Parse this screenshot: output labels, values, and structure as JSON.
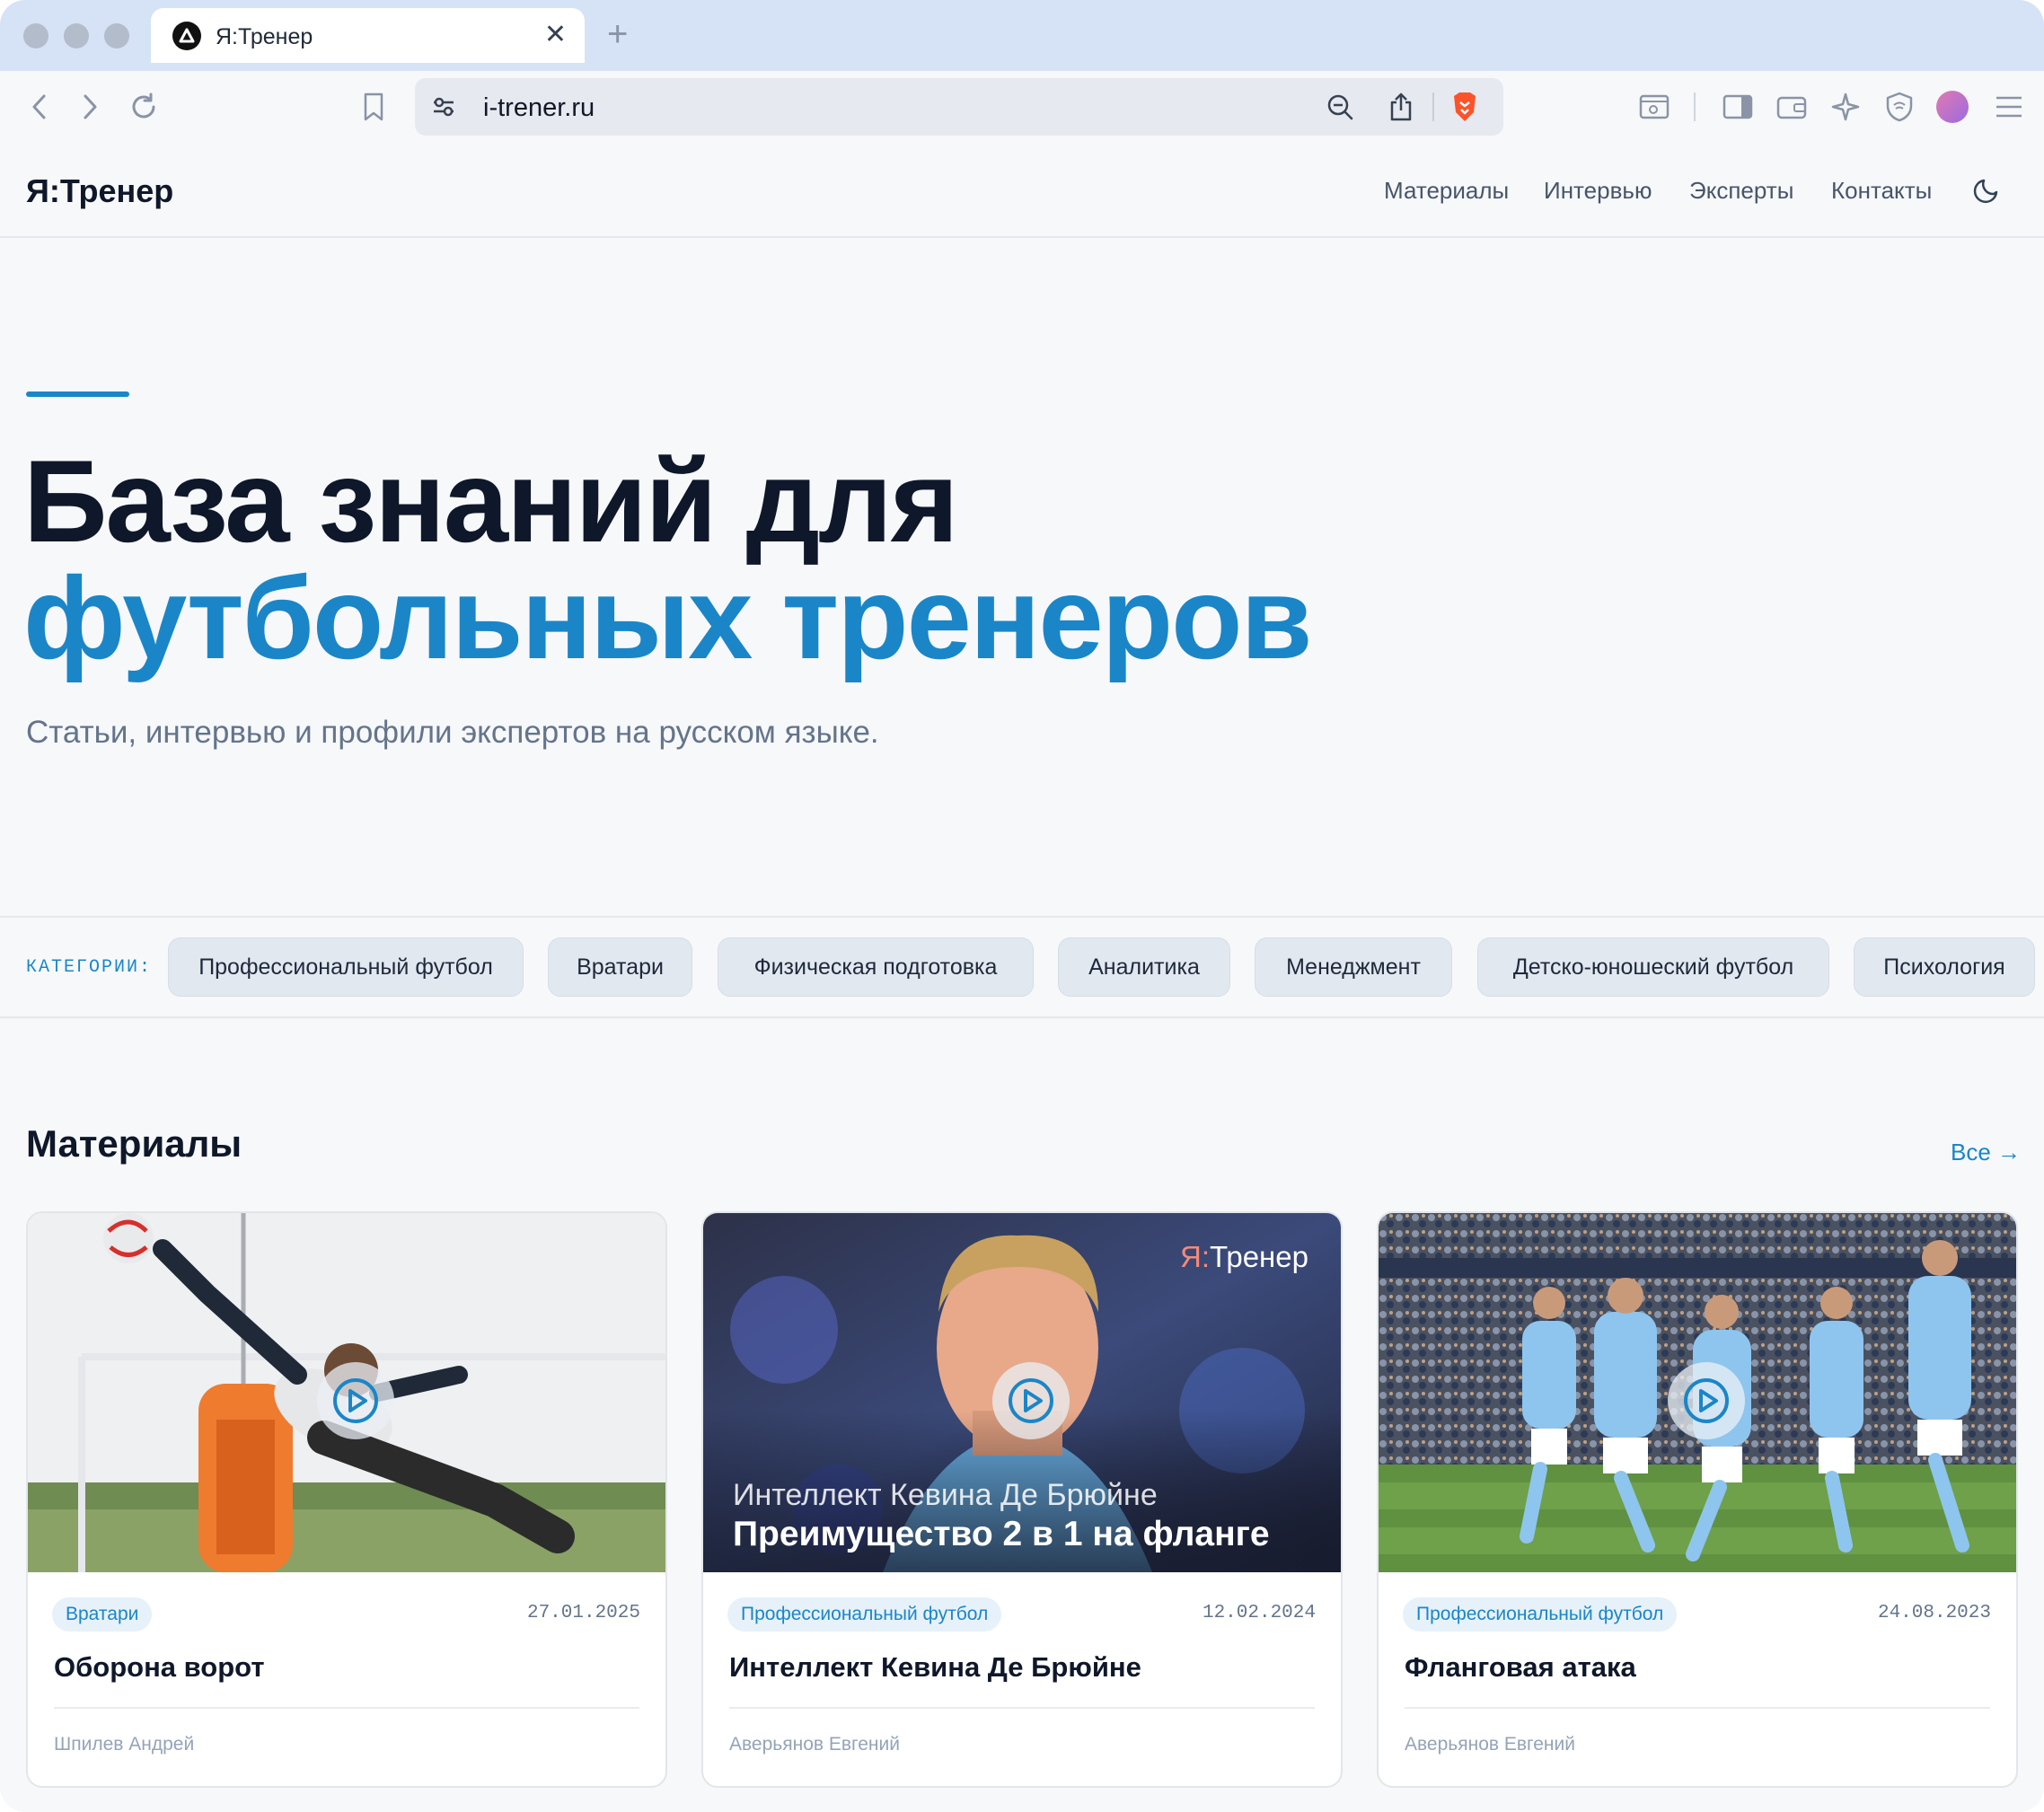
{
  "browser": {
    "tab_title": "Я:Тренер",
    "new_tab": "+",
    "close": "✕",
    "url": "i-trener.ru"
  },
  "site": {
    "logo": "Я:Тренер",
    "nav": [
      "Материалы",
      "Интервью",
      "Эксперты",
      "Контакты"
    ]
  },
  "hero": {
    "line1": "База знаний для",
    "line2": "футбольных тренеров",
    "subtitle": "Статьи, интервью и профили экспертов на русском языке."
  },
  "categories": {
    "label": "КАТЕГОРИИ:",
    "items": [
      "Профессиональный футбол",
      "Вратари",
      "Физическая подготовка",
      "Аналитика",
      "Менеджмент",
      "Детско-юношеский футбол",
      "Психология"
    ]
  },
  "materials": {
    "title": "Материалы",
    "see_all": "Все →",
    "cards": [
      {
        "tag": "Вратари",
        "date": "27.01.2025",
        "title": "Оборона ворот",
        "author": "Шпилев Андрей"
      },
      {
        "tag": "Профессиональный футбол",
        "date": "12.02.2024",
        "title": "Интеллект Кевина Де Брюйне",
        "author": "Аверьянов Евгений",
        "overlay_logo_prefix": "Я:",
        "overlay_logo_rest": "Тренер",
        "overlay_kicker": "Интеллект Кевина Де Брюйне",
        "overlay_title": "Преимущество 2 в 1 на фланге"
      },
      {
        "tag": "Профессиональный футбол",
        "date": "24.08.2023",
        "title": "Фланговая атака",
        "author": "Аверьянов Евгений"
      }
    ]
  },
  "colors": {
    "accent": "#1a86c8",
    "text": "#0f172a",
    "muted": "#64748b",
    "page_bg": "#f7f8fa",
    "brave_orange": "#fb542b"
  },
  "icons": [
    "back-icon",
    "forward-icon",
    "reload-icon",
    "bookmark-icon",
    "site-settings-icon",
    "zoom-out-icon",
    "share-icon",
    "brave-shield-icon",
    "screenshot-icon",
    "sidebar-icon",
    "wallet-icon",
    "leo-ai-icon",
    "vpn-icon",
    "profile-avatar",
    "menu-icon",
    "moon-icon",
    "play-icon"
  ]
}
